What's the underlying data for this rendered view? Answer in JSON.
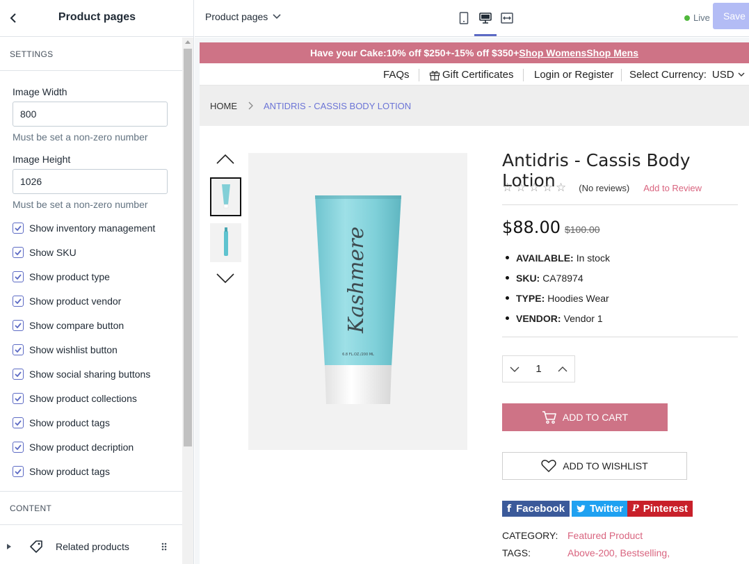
{
  "sidebar": {
    "title": "Product pages",
    "settings_heading": "SETTINGS",
    "image_width": {
      "label": "Image Width",
      "value": "800",
      "help": "Must be set a non-zero number"
    },
    "image_height": {
      "label": "Image Height",
      "value": "1026",
      "help": "Must be set a non-zero number"
    },
    "checkboxes": [
      {
        "label": "Show inventory management",
        "checked": true
      },
      {
        "label": "Show SKU",
        "checked": true
      },
      {
        "label": "Show product type",
        "checked": true
      },
      {
        "label": "Show product vendor",
        "checked": true
      },
      {
        "label": "Show compare button",
        "checked": true
      },
      {
        "label": "Show wishlist button",
        "checked": true
      },
      {
        "label": "Show social sharing buttons",
        "checked": true
      },
      {
        "label": "Show product collections",
        "checked": true
      },
      {
        "label": "Show product tags",
        "checked": true
      },
      {
        "label": "Show product decription",
        "checked": true
      },
      {
        "label": "Show product tags",
        "checked": true
      }
    ],
    "content_heading": "CONTENT",
    "related_products_label": "Related products"
  },
  "topbar": {
    "page_selector": "Product pages",
    "live_label": "Live",
    "save_label": "Save",
    "accent_color": "#5c6ac4"
  },
  "store": {
    "promo": {
      "lead": "Have your Cake:",
      "offer1": "10% off $250+",
      "separator": "-",
      "offer2": "15% off $350+",
      "link_womens": "Shop Womens",
      "link_mens": "Shop Mens",
      "color": "#ce7386"
    },
    "utility_nav": {
      "faqs": "FAQs",
      "gift": "Gift Certificates",
      "login": "Login or Register",
      "currency_label": "Select Currency:",
      "currency_value": "USD"
    },
    "breadcrumb": {
      "home": "HOME",
      "current": "ANTIDRIS - CASSIS BODY LOTION"
    },
    "product": {
      "title": "Antidris - Cassis Body Lotion",
      "reviews": "(No reviews)",
      "add_review": "Add to Review",
      "price": "$88.00",
      "old_price": "$100.00",
      "tube_brand": "Kashmere",
      "tube_size": "6.8 FL.OZ./200 ML",
      "specs": [
        {
          "key": "AVAILABLE:",
          "value": "In stock"
        },
        {
          "key": "SKU:",
          "value": "CA78974"
        },
        {
          "key": "TYPE:",
          "value": "Hoodies Wear"
        },
        {
          "key": "VENDOR:",
          "value": "Vendor 1"
        }
      ],
      "quantity": "1",
      "add_to_cart": "ADD TO CART",
      "add_to_wishlist": "ADD TO WISHLIST",
      "social": {
        "facebook": "Facebook",
        "twitter": "Twitter",
        "pinterest": "Pinterest"
      },
      "category_label": "CATEGORY:",
      "category_value": "Featured Product",
      "tags_label": "TAGS:",
      "tags_value": "Above-200, Bestselling,"
    }
  }
}
